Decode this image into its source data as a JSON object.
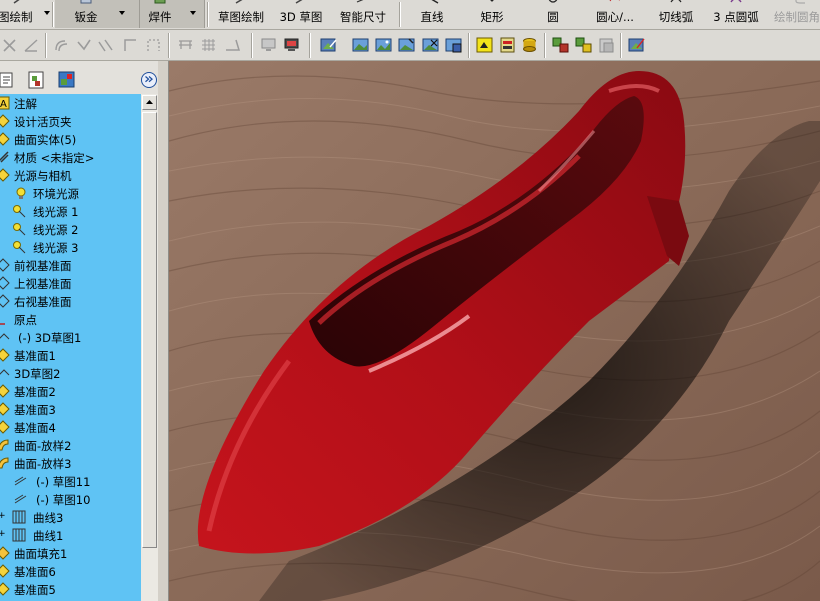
{
  "command_bar": {
    "items": [
      {
        "label": "图绘制",
        "icon": "sketch-icon"
      },
      {
        "label": "钣金",
        "icon": "sheet-metal-icon"
      },
      {
        "label": "焊件",
        "icon": "weldment-icon"
      },
      {
        "label": "草图绘制",
        "icon": "sketch-icon"
      },
      {
        "label": "3D 草图",
        "icon": "3d-sketch-icon"
      },
      {
        "label": "智能尺寸",
        "icon": "smart-dimension-icon"
      },
      {
        "label": "直线",
        "icon": "line-icon"
      },
      {
        "label": "矩形",
        "icon": "rectangle-icon"
      },
      {
        "label": "圆",
        "icon": "circle-icon"
      },
      {
        "label": "圆心/...",
        "icon": "centerpoint-arc-icon"
      },
      {
        "label": "切线弧",
        "icon": "tangent-arc-icon"
      },
      {
        "label": "3 点圆弧",
        "icon": "3-point-arc-icon"
      },
      {
        "label": "绘制圆角",
        "icon": "sketch-fillet-icon"
      }
    ]
  },
  "feature_tree": {
    "items": [
      {
        "label": "注解",
        "icon": "annotations-icon"
      },
      {
        "label": "设计活页夹",
        "icon": "design-binder-icon"
      },
      {
        "label": "曲面实体(5)",
        "icon": "surface-bodies-icon"
      },
      {
        "label": "材质 <未指定>",
        "icon": "material-icon"
      },
      {
        "label": "光源与相机",
        "icon": "lights-cameras-icon"
      },
      {
        "label": "环境光源",
        "icon": "ambient-light-icon"
      },
      {
        "label": "线光源 1",
        "icon": "directional-light-icon"
      },
      {
        "label": "线光源 2",
        "icon": "directional-light-icon"
      },
      {
        "label": "线光源 3",
        "icon": "directional-light-icon"
      },
      {
        "label": "前视基准面",
        "icon": "plane-icon"
      },
      {
        "label": "上视基准面",
        "icon": "plane-icon"
      },
      {
        "label": "右视基准面",
        "icon": "plane-icon"
      },
      {
        "label": "原点",
        "icon": "origin-icon"
      },
      {
        "label": "(-) 3D草图1",
        "icon": "3d-sketch-icon"
      },
      {
        "label": "基准面1",
        "icon": "plane-icon"
      },
      {
        "label": "3D草图2",
        "icon": "3d-sketch-icon"
      },
      {
        "label": "基准面2",
        "icon": "plane-icon"
      },
      {
        "label": "基准面3",
        "icon": "plane-icon"
      },
      {
        "label": "基准面4",
        "icon": "plane-icon"
      },
      {
        "label": "曲面-放样2",
        "icon": "surface-loft-icon"
      },
      {
        "label": "曲面-放样3",
        "icon": "surface-loft-icon"
      },
      {
        "label": "(-) 草图11",
        "icon": "sketch-icon"
      },
      {
        "label": "(-) 草图10",
        "icon": "sketch-icon"
      },
      {
        "label": "曲线3",
        "icon": "curve-icon"
      },
      {
        "label": "曲线1",
        "icon": "curve-icon"
      },
      {
        "label": "曲面填充1",
        "icon": "surface-fill-icon"
      },
      {
        "label": "基准面6",
        "icon": "plane-icon"
      },
      {
        "label": "基准面5",
        "icon": "plane-icon"
      }
    ]
  },
  "colors": {
    "tree_background": "#5fc3f4",
    "shoe_red": "#b8111a",
    "wood": "#8a6a58"
  }
}
